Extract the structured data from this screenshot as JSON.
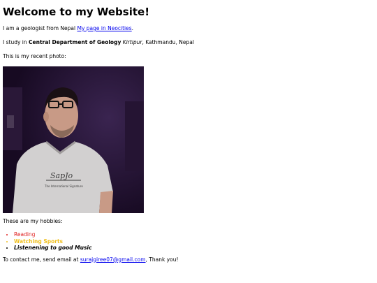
{
  "page": {
    "title": "Welcome to my Website!",
    "intro": {
      "text": "I am a geologist from Nepal",
      "link_label": "My page in Neocities",
      "suffix": "."
    },
    "study": {
      "prefix": "I study in",
      "department": "Central Department of Geology",
      "place_italic": "Kirtipur",
      "rest": ", Kathmandu, Nepal"
    },
    "photo_caption": "This is my recent photo:",
    "photo": {
      "shirt_text": "The International Signature",
      "shirt_logo": "SapJo"
    },
    "hobbies_intro": "These are my hobbies:",
    "hobbies": [
      {
        "label": "Reading",
        "color": "#e02020"
      },
      {
        "label": "Watching Sports",
        "color": "#f0c020"
      },
      {
        "label": "Listenening to good Music",
        "color": "#000000"
      }
    ],
    "contact": {
      "prefix": "To contact me, send email at",
      "email": "surajgiree07@gmail.com",
      "suffix": ", Thank you!"
    }
  },
  "colors": {
    "link": "#0000ee",
    "photo_background": "#1f102b"
  }
}
